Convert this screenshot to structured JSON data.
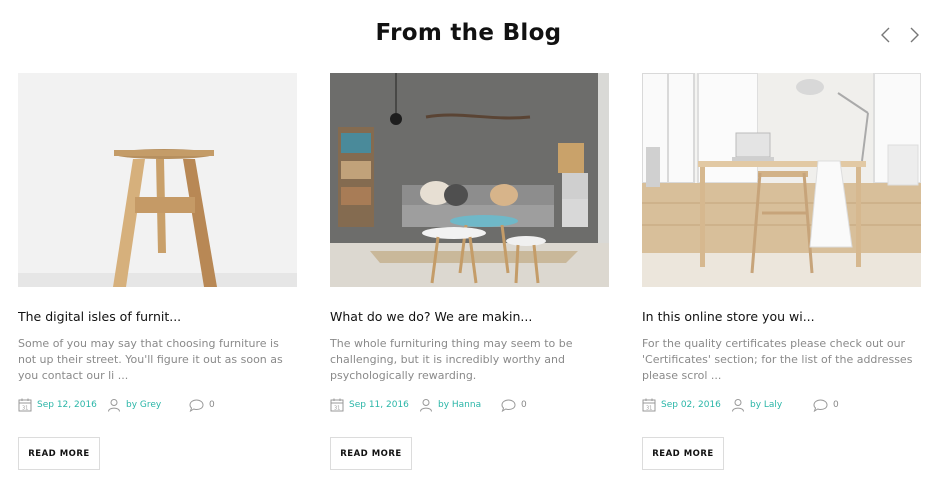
{
  "section": {
    "title": "From the Blog"
  },
  "nav": {
    "prev_icon": "chevron-left-icon",
    "next_icon": "chevron-right-icon"
  },
  "posts": [
    {
      "title": "The digital isles of furnit...",
      "excerpt": "Some of you may say that choosing furniture is not up their street. You'll figure it out as soon as you contact our li ...",
      "date": "Sep 12, 2016",
      "author": "by Grey",
      "comments": "0",
      "read_more": "READ MORE",
      "image": "wooden-stool-photo"
    },
    {
      "title": "What do we do? We are makin...",
      "excerpt": "The whole furnituring thing may seem to be challenging, but it is incredibly worthy and psychologically rewarding.",
      "date": "Sep 11, 2016",
      "author": "by Hanna",
      "comments": "0",
      "read_more": "READ MORE",
      "image": "living-room-photo"
    },
    {
      "title": "In this online store you wi...",
      "excerpt": "For the quality certificates please check out our 'Certificates' section; for the list of the addresses please scrol ...",
      "date": "Sep 02, 2016",
      "author": "by Laly",
      "comments": "0",
      "read_more": "READ MORE",
      "image": "home-office-photo"
    }
  ],
  "colors": {
    "accent": "#2bb6a8",
    "text": "#111111",
    "muted": "#8a8a8a",
    "border": "#dcdcdc"
  }
}
